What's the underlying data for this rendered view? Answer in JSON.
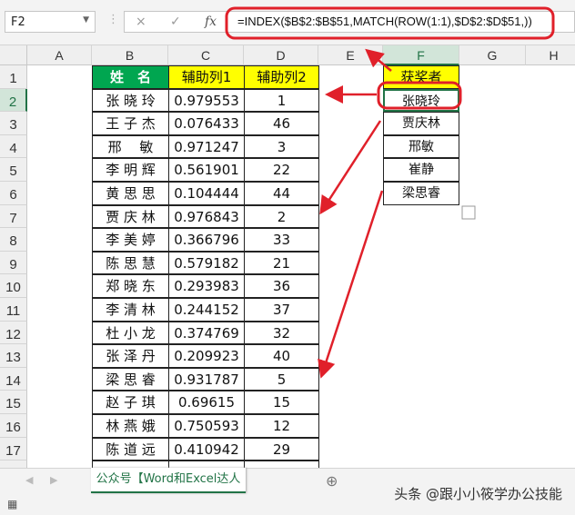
{
  "name_box": "F2",
  "formula": "=INDEX($B$2:$B$51,MATCH(ROW(1:1),$D$2:$D$51,))",
  "icons": {
    "cancel": "×",
    "enter": "✓",
    "fx": "fx"
  },
  "columns": [
    "A",
    "B",
    "C",
    "D",
    "E",
    "F",
    "G",
    "H"
  ],
  "rows": [
    "1",
    "2",
    "3",
    "4",
    "5",
    "6",
    "7",
    "8",
    "9",
    "10",
    "11",
    "12",
    "13",
    "14",
    "15",
    "16",
    "17"
  ],
  "headers": {
    "name": "姓　名",
    "aux1": "辅助列1",
    "aux2": "辅助列2",
    "winner": "获奖者"
  },
  "table": [
    [
      "张 晓 玲",
      "0.979553",
      "1"
    ],
    [
      "王 子 杰",
      "0.076433",
      "46"
    ],
    [
      "邢　 敏",
      "0.971247",
      "3"
    ],
    [
      "李 明 辉",
      "0.561901",
      "22"
    ],
    [
      "黄 思 思",
      "0.104444",
      "44"
    ],
    [
      "贾 庆 林",
      "0.976843",
      "2"
    ],
    [
      "李 美 婷",
      "0.366796",
      "33"
    ],
    [
      "陈 思 慧",
      "0.579182",
      "21"
    ],
    [
      "郑 晓 东",
      "0.293983",
      "36"
    ],
    [
      "李 清 林",
      "0.244152",
      "37"
    ],
    [
      "杜 小 龙",
      "0.374769",
      "32"
    ],
    [
      "张 泽 丹",
      "0.209923",
      "40"
    ],
    [
      "梁 思 睿",
      "0.931787",
      "5"
    ],
    [
      "赵 子 琪",
      "0.69615",
      "15"
    ],
    [
      "林 燕 娥",
      "0.750593",
      "12"
    ],
    [
      "陈 道 远",
      "0.410942",
      "29"
    ]
  ],
  "winners": [
    "张晓玲",
    "贾庆林",
    "邢敏",
    "崔静",
    "梁思睿"
  ],
  "sheet_tab": "公众号【Word和Excel达人先生】",
  "watermark": "头条 @跟小小筱学办公技能",
  "colors": {
    "green": "#00a650",
    "yellow": "#ffff00",
    "annotation": "#e0202a"
  }
}
